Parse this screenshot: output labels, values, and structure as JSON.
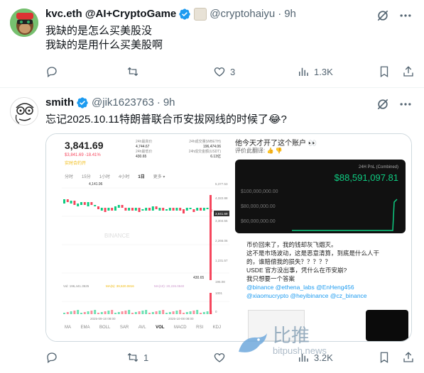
{
  "tweet1": {
    "name": "kvc.eth @AI+CryptoGame",
    "handle": "@cryptohaiyu",
    "time": "9h",
    "text_lines": [
      "我缺的是怎么买美股没",
      "我缺的是用什么买美股啊"
    ],
    "actions": {
      "replies": "",
      "retweets": "",
      "likes": "3",
      "views": "1.3K"
    }
  },
  "tweet2": {
    "name": "smith",
    "handle": "@jik1623763",
    "time": "9h",
    "text": "忘记2025.10.11特朗普联合币安拔网线的时候了😂?",
    "actions": {
      "replies": "",
      "retweets": "1",
      "likes": "",
      "views": "3.2K"
    }
  },
  "left_panel": {
    "price": "3,841.69",
    "change": "$3,841.69  -18.41%",
    "tag": "实时合约开",
    "stats": [
      {
        "label": "24h最高价",
        "value": "4,744.67"
      },
      {
        "label": "24h成交量(WBETH)",
        "value": "196,474.06"
      },
      {
        "label": "24h最低价",
        "value": "430.65"
      },
      {
        "label": "24h成交金额(USDT)",
        "value": "6.13亿"
      }
    ],
    "timeframes": [
      "分时",
      "15分",
      "1小时",
      "4小时",
      "1日",
      "更多 ▾"
    ],
    "active_timeframe": "1日",
    "y_ticks": [
      "5,377.53",
      "4,322.88",
      "3,841.69",
      "3,304.55",
      "2,266.06",
      "1,231.57",
      "195.08",
      "1001",
      "0"
    ],
    "high_label": "4,141.96",
    "low_label": "430.65",
    "vol_line": "Vol: 196,441.3525",
    "ma_line": "MA(5): 39,520.0816",
    "ma10_line": "MA(10): 20,226.0840",
    "date_left": "2025-09-18 08:00",
    "date_right": "2025-10-08 08:00",
    "indicators": [
      "MA",
      "EMA",
      "BOLL",
      "SAR",
      "AVL",
      "VOL",
      "MACD",
      "RSI",
      "KDJ"
    ],
    "active_indicator": "VOL",
    "watermark": "BINANCE"
  },
  "right_top": {
    "title": "他今天才开了这个账户 👀",
    "sub": "评价此翻译: 👍 👎",
    "pnl_label": "24H PnL (Combined)",
    "pnl_value": "$88,591,097.81",
    "y_ticks": [
      "$100,000,000.00",
      "$80,000,000.00",
      "$60,000,000.00"
    ]
  },
  "right_bottom": {
    "lines": [
      "币价回来了，我的钱却灰飞烟灭。",
      "这不是市场波动，这是恶意清算，到底是什么人干",
      "的，谁赔偿我的损失？？？？？",
      "USDE 官方没出事，凭什么在币安崩?",
      "我只想要一个答案"
    ],
    "mentions_1": "@binance @ethena_labs @EnHeng456",
    "mentions_2": "@xiaomucrypto @heyibinance @cz_binance"
  },
  "watermark": {
    "text": "比推",
    "url": "bitpush.news"
  },
  "colors": {
    "verified": "#1d9bf0",
    "muted": "#536471",
    "accent": "#1d9bf0",
    "up": "#0ecb81",
    "down": "#f6465d"
  }
}
